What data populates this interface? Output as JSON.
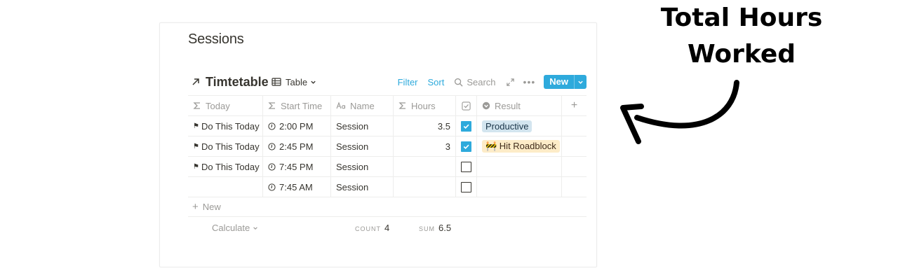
{
  "page": {
    "title": "Sessions"
  },
  "database": {
    "title": "Timtetable",
    "view_label": "Table",
    "toolbar": {
      "filter": "Filter",
      "sort": "Sort",
      "search": "Search",
      "new": "New"
    }
  },
  "columns": [
    "Today",
    "Start Time",
    "Name",
    "Hours",
    "",
    "Result"
  ],
  "rows": [
    {
      "today": "Do This Today",
      "start_time": "2:00 PM",
      "name": "Session",
      "hours": "3.5",
      "done": true,
      "result": "Productive"
    },
    {
      "today": "Do This Today",
      "start_time": "2:45 PM",
      "name": "Session",
      "hours": "3",
      "done": true,
      "result": "🚧 Hit Roadblock"
    },
    {
      "today": "Do This Today",
      "start_time": "7:45 PM",
      "name": "Session",
      "hours": "",
      "done": false,
      "result": ""
    },
    {
      "today": "",
      "start_time": "7:45 AM",
      "name": "Session",
      "hours": "",
      "done": false,
      "result": ""
    }
  ],
  "footer": {
    "new_label": "New",
    "calculate_label": "Calculate",
    "count_label": "COUNT",
    "count_value": "4",
    "sum_label": "SUM",
    "sum_value": "6.5"
  },
  "annotation": {
    "line1": "Total Hours",
    "line2": "Worked"
  },
  "colors": {
    "accent": "#2eaadc",
    "tag_productive": "#d3e5ef",
    "tag_roadblock": "#fdecc8",
    "text": "#37352f",
    "muted": "#9b9a97"
  },
  "icons": [
    "arrow-up-right-icon",
    "table-icon",
    "chevron-down-icon",
    "search-icon",
    "expand-icon",
    "more-icon",
    "sigma-icon",
    "text-icon",
    "checkbox-icon",
    "select-icon",
    "plus-icon",
    "flag-icon",
    "clock-icon",
    "check-icon"
  ]
}
